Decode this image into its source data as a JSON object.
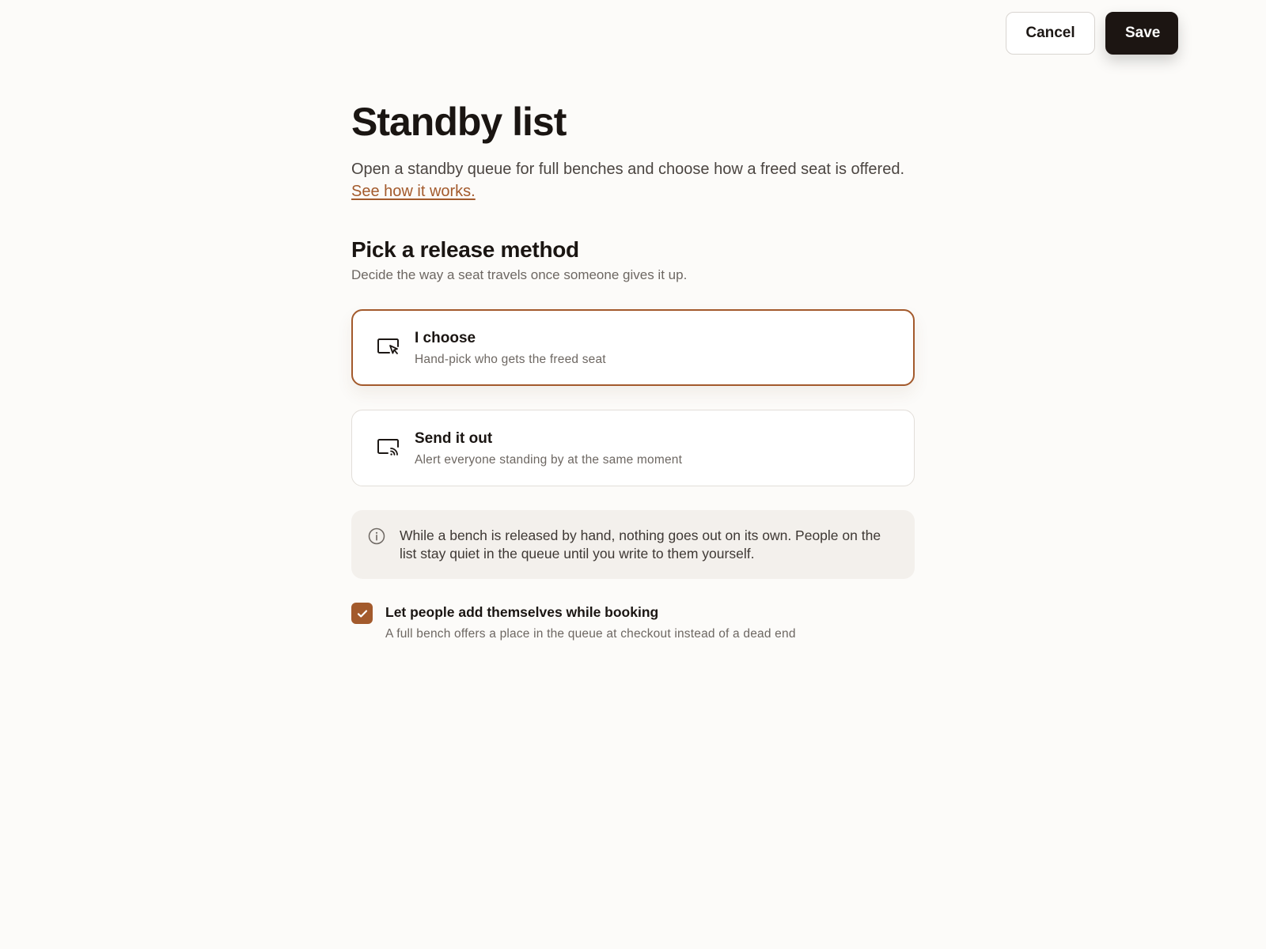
{
  "toolbar": {
    "cancel_label": "Cancel",
    "save_label": "Save"
  },
  "page": {
    "title": "Standby list",
    "description": "Open a standby queue for full benches and choose how a freed seat is offered.",
    "link_label": "See how it works."
  },
  "section": {
    "title": "Pick a release method",
    "subtitle": "Decide the way a seat travels once someone gives it up."
  },
  "options": [
    {
      "title": "I choose",
      "description": "Hand-pick who gets the freed seat",
      "icon": "screen-cursor-icon",
      "selected": true
    },
    {
      "title": "Send it out",
      "description": "Alert everyone standing by at the same moment",
      "icon": "screen-broadcast-icon",
      "selected": false
    }
  ],
  "notice": {
    "icon": "info-icon",
    "text": "While a bench is released by hand, nothing goes out on its own. People on the list stay quiet in the queue until you write to them yourself."
  },
  "self_add": {
    "checked": true,
    "label": "Let people add themselves while booking",
    "description": "A full bench offers a place in the queue at checkout instead of a dead end"
  },
  "colors": {
    "accent": "#a35a2c",
    "background": "#fcfbf9",
    "primary_button": "#1c1512",
    "notice_bg": "#f3f0ec"
  }
}
